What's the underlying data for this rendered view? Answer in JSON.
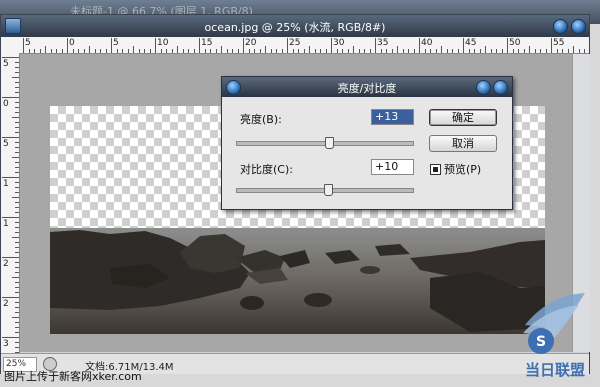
{
  "background_window": {
    "title": "未标题-1 @ 66.7% (图层 1, RGB/8)"
  },
  "document": {
    "title": "ocean.jpg @ 25% (水流, RGB/8#)",
    "ruler_h_labels": [
      "5",
      "0",
      "5",
      "10",
      "15",
      "20",
      "25",
      "30",
      "35",
      "40",
      "45",
      "50",
      "55"
    ],
    "ruler_v_labels": [
      "5",
      "0",
      "5",
      "1",
      "1",
      "2",
      "2",
      "3"
    ],
    "zoom": "25%",
    "doc_size": "文档:6.71M/13.4M"
  },
  "dialog": {
    "title": "亮度/对比度",
    "brightness_label": "亮度(B):",
    "brightness_value": "+13",
    "brightness_level": 0.53,
    "contrast_label": "对比度(C):",
    "contrast_value": "+10",
    "contrast_level": 0.52,
    "ok_label": "确定",
    "cancel_label": "取消",
    "preview_label": "预览(P)",
    "preview_checked": true
  },
  "watermark": {
    "text": "图片上传于新客网xker.com",
    "logo_text": "当日联盟"
  }
}
